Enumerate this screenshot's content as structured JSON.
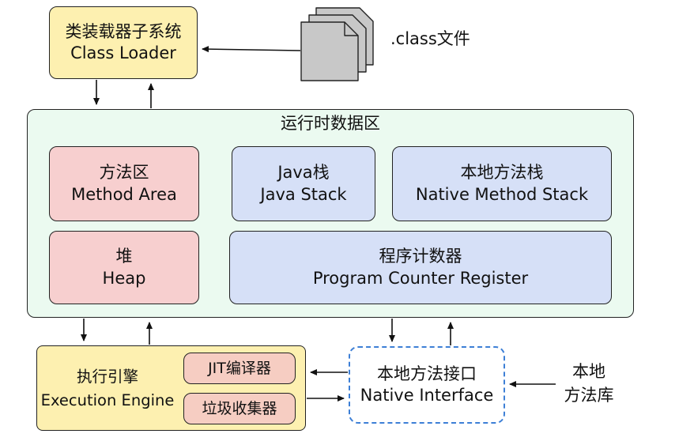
{
  "class_loader": {
    "cn": "类装载器子系统",
    "en": "Class Loader"
  },
  "class_files": {
    "label": ".class文件"
  },
  "runtime_area": {
    "title": "运行时数据区",
    "method_area": {
      "cn": "方法区",
      "en": "Method Area"
    },
    "java_stack": {
      "cn": "Java栈",
      "en": "Java Stack"
    },
    "native_stack": {
      "cn": "本地方法栈",
      "en": "Native Method Stack"
    },
    "heap": {
      "cn": "堆",
      "en": "Heap"
    },
    "pc_register": {
      "cn": "程序计数器",
      "en": "Program Counter Register"
    }
  },
  "execution_engine": {
    "cn": "执行引擎",
    "en": "Execution Engine",
    "jit": "JIT编译器",
    "gc": "垃圾收集器"
  },
  "native_interface": {
    "cn": "本地方法接口",
    "en": "Native Interface"
  },
  "native_library": {
    "line1": "本地",
    "line2": "方法库"
  },
  "colors": {
    "loader": "#fdf0b0",
    "runtime": "#ebfaf0",
    "method_heap": "#f7cfcf",
    "stacks": "#d6e0f7",
    "engine_sub": "#f6cdc2",
    "native_interface_border": "#3d7fd6",
    "file_icon": "#c8c8c8"
  }
}
